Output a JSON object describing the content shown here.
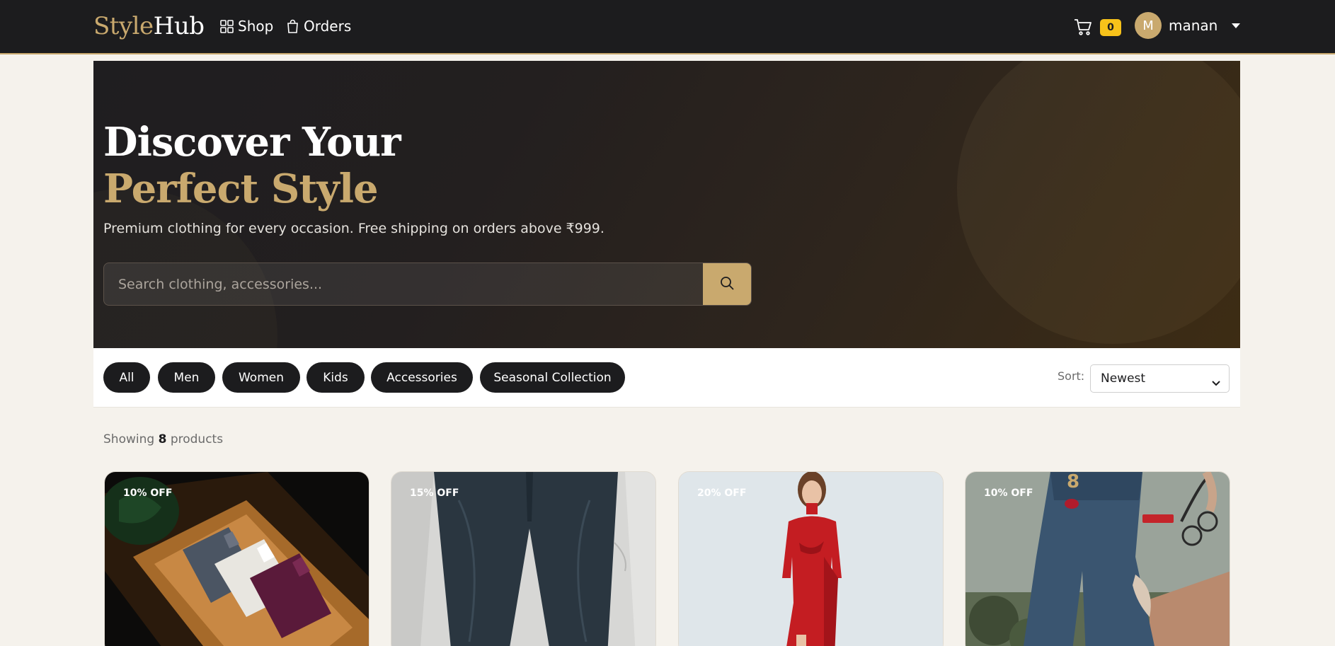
{
  "brand": {
    "part1": "Style",
    "part2": "Hub"
  },
  "nav": {
    "shop_label": "Shop",
    "orders_label": "Orders"
  },
  "cart": {
    "count": "0"
  },
  "user": {
    "initial": "M",
    "name": "manan"
  },
  "hero": {
    "title_line1": "Discover Your",
    "title_line2": "Perfect Style",
    "subtitle": "Premium clothing for every occasion. Free shipping on orders above ₹999.",
    "search_placeholder": "Search clothing, accessories..."
  },
  "filters": {
    "categories": [
      "All",
      "Men",
      "Women",
      "Kids",
      "Accessories",
      "Seasonal Collection"
    ],
    "sort_label": "Sort:",
    "sort_value": "Newest"
  },
  "listing": {
    "showing_prefix": "Showing",
    "count": "8",
    "showing_suffix": "products"
  },
  "products": [
    {
      "discount": "10% OFF",
      "image": "folded-shirts-on-wooden-tray"
    },
    {
      "discount": "15% OFF",
      "image": "dark-denim-jeans"
    },
    {
      "discount": "20% OFF",
      "image": "woman-in-red-dress"
    },
    {
      "discount": "10% OFF",
      "image": "ripped-jeans-with-sunglasses"
    }
  ],
  "colors": {
    "accent": "#c9a96e",
    "dark": "#1c1c1e",
    "badge": "#f7c21a"
  }
}
